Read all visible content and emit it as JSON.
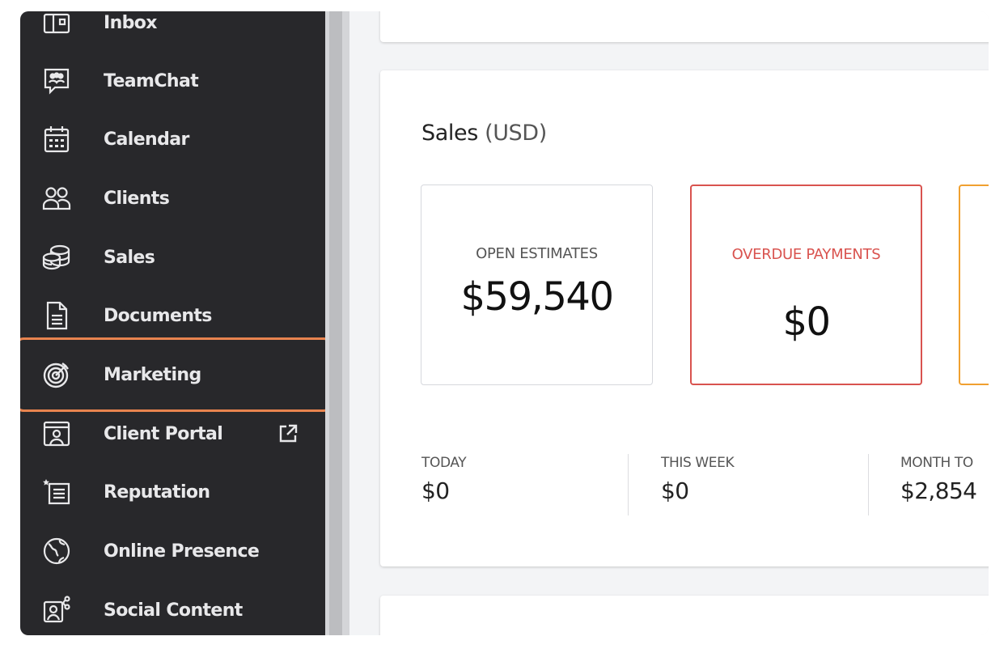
{
  "sidebar": {
    "items": [
      {
        "label": "Inbox",
        "icon": "inbox-icon"
      },
      {
        "label": "TeamChat",
        "icon": "team-chat-icon"
      },
      {
        "label": "Calendar",
        "icon": "calendar-icon"
      },
      {
        "label": "Clients",
        "icon": "clients-icon"
      },
      {
        "label": "Sales",
        "icon": "sales-icon"
      },
      {
        "label": "Documents",
        "icon": "documents-icon"
      },
      {
        "label": "Marketing",
        "icon": "marketing-icon",
        "active": true
      },
      {
        "label": "Client Portal",
        "icon": "client-portal-icon",
        "trailing_icon": "external-link-icon"
      },
      {
        "label": "Reputation",
        "icon": "reputation-icon"
      },
      {
        "label": "Online Presence",
        "icon": "globe-icon"
      },
      {
        "label": "Social Content",
        "icon": "social-content-icon"
      }
    ]
  },
  "sales": {
    "title": "Sales",
    "unit": "(USD)",
    "open_estimates": {
      "label": "OPEN ESTIMATES",
      "value": "$59,540"
    },
    "overdue_payments": {
      "label": "OVERDUE PAYMENTS",
      "value": "$0"
    },
    "periods": [
      {
        "label": "TODAY",
        "value": "$0"
      },
      {
        "label": "THIS WEEK",
        "value": "$0"
      },
      {
        "label": "MONTH TO",
        "value": "$2,854"
      }
    ]
  },
  "colors": {
    "sidebar_bg": "#28282b",
    "active_highlight": "#e8844f",
    "overdue_red": "#d9534f",
    "third_box_orange": "#f0a030"
  }
}
